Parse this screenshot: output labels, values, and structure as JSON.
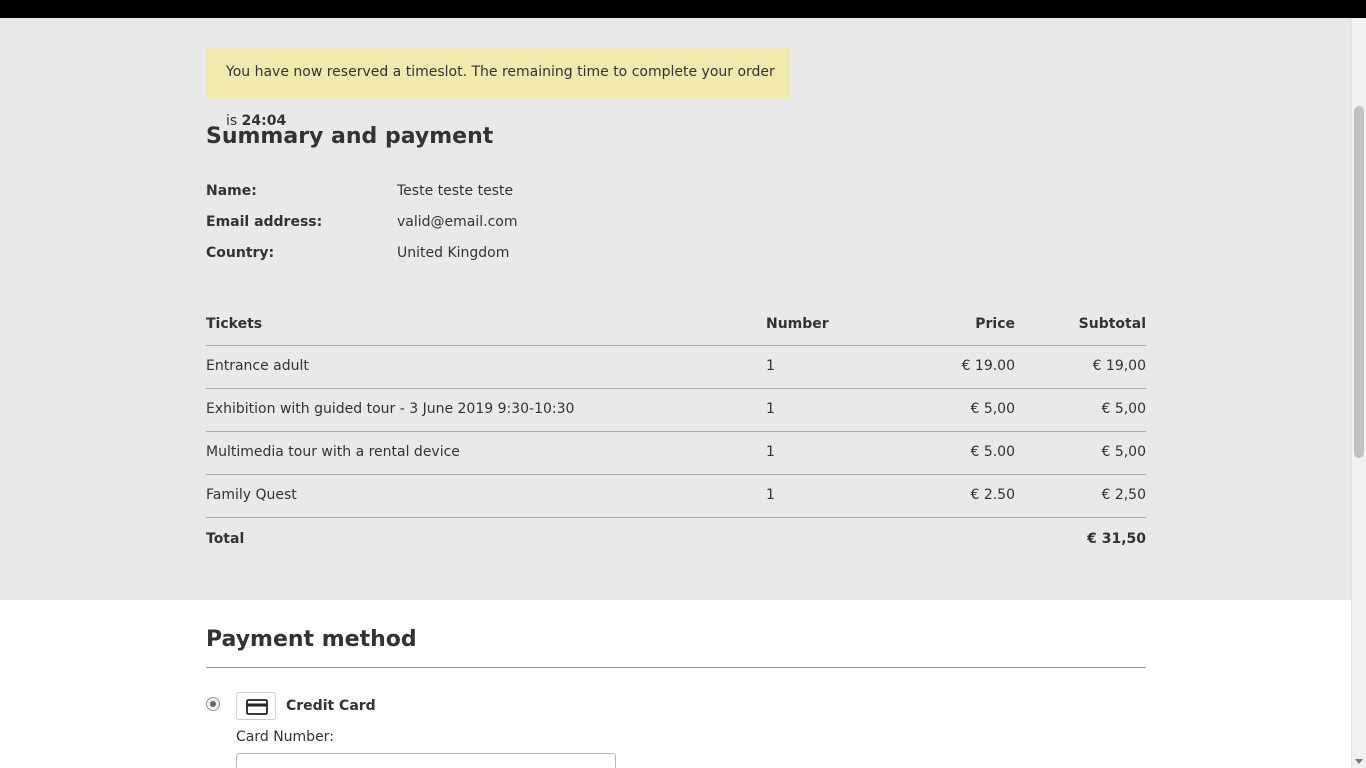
{
  "notice": {
    "text": "You have now reserved a timeslot. The remaining time to complete your order is ",
    "time": "24:04"
  },
  "summary": {
    "title": "Summary and payment",
    "fields": [
      {
        "label": "Name:",
        "value": "Teste teste teste"
      },
      {
        "label": "Email address:",
        "value": "valid@email.com"
      },
      {
        "label": "Country:",
        "value": "United Kingdom"
      }
    ]
  },
  "tickets": {
    "headers": {
      "ticket": "Tickets",
      "number": "Number",
      "price": "Price",
      "subtotal": "Subtotal"
    },
    "rows": [
      {
        "name": "Entrance adult",
        "number": "1",
        "price": "€ 19.00",
        "subtotal": "€ 19,00"
      },
      {
        "name": "Exhibition with guided tour - 3 June 2019 9:30-10:30",
        "number": "1",
        "price": "€ 5,00",
        "subtotal": "€ 5,00"
      },
      {
        "name": "Multimedia tour with a rental device",
        "number": "1",
        "price": "€ 5.00",
        "subtotal": "€ 5,00"
      },
      {
        "name": "Family Quest",
        "number": "1",
        "price": "€ 2.50",
        "subtotal": "€ 2,50"
      }
    ],
    "total_label": "Total",
    "total_value": "€ 31,50"
  },
  "payment": {
    "title": "Payment method",
    "method_label": "Credit Card",
    "method_icon": "credit-card-icon",
    "card_number_label": "Card Number:",
    "card_number_value": ""
  }
}
